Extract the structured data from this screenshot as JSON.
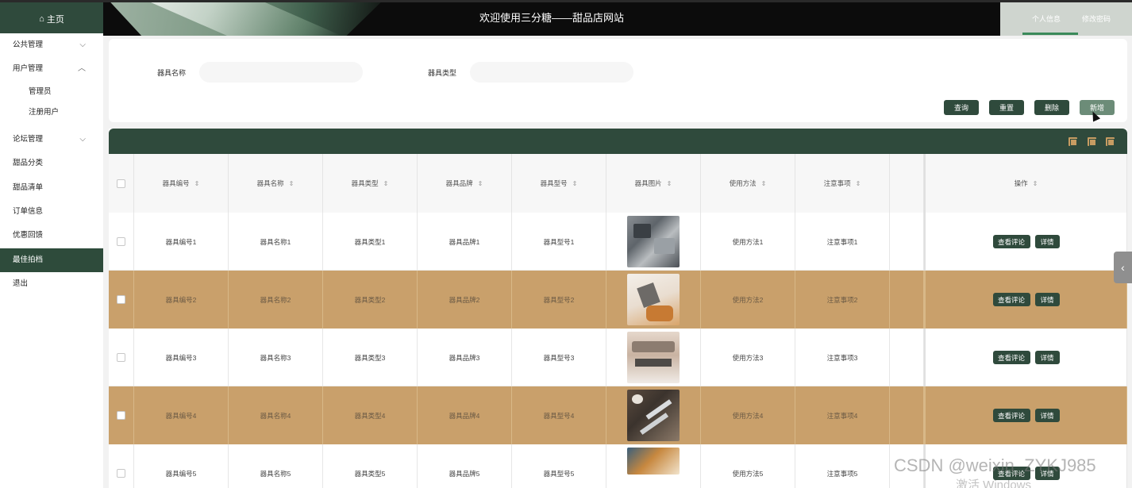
{
  "header": {
    "home_label": "主页",
    "site_title": "欢迎使用三分糖——甜品店网站",
    "links": [
      "个人信息",
      "修改密码"
    ]
  },
  "sidebar": {
    "items": [
      {
        "label": "公共管理",
        "chevron": "chevron-down-icon"
      },
      {
        "label": "用户管理",
        "chevron": "chevron-up-icon"
      },
      {
        "label": "管理员"
      },
      {
        "label": "注册用户"
      },
      {
        "label": "论坛管理",
        "chevron": "chevron-down-icon"
      },
      {
        "label": "甜品分类"
      },
      {
        "label": "甜品清单"
      },
      {
        "label": "订单信息"
      },
      {
        "label": "优惠回馈"
      },
      {
        "label": "最佳拍档"
      },
      {
        "label": "退出"
      }
    ],
    "active_index": 9
  },
  "search": {
    "name_label": "器具名称",
    "name_value": "",
    "type_label": "器具类型",
    "type_value": "",
    "buttons": {
      "query": "查询",
      "reset": "重置",
      "delete": "删除",
      "add": "新增"
    }
  },
  "table": {
    "columns": [
      "器具编号",
      "器具名称",
      "器具类型",
      "器具品牌",
      "器具型号",
      "器具图片",
      "使用方法",
      "注意事项",
      "",
      "操作"
    ],
    "rows": [
      {
        "no": "器具编号1",
        "name": "器具名称1",
        "type": "器具类型1",
        "brand": "器具品牌1",
        "model": "器具型号1",
        "usage": "使用方法1",
        "notes": "注意事项1"
      },
      {
        "no": "器具编号2",
        "name": "器具名称2",
        "type": "器具类型2",
        "brand": "器具品牌2",
        "model": "器具型号2",
        "usage": "使用方法2",
        "notes": "注意事项2"
      },
      {
        "no": "器具编号3",
        "name": "器具名称3",
        "type": "器具类型3",
        "brand": "器具品牌3",
        "model": "器具型号3",
        "usage": "使用方法3",
        "notes": "注意事项3"
      },
      {
        "no": "器具编号4",
        "name": "器具名称4",
        "type": "器具类型4",
        "brand": "器具品牌4",
        "model": "器具型号4",
        "usage": "使用方法4",
        "notes": "注意事项4"
      },
      {
        "no": "器具编号5",
        "name": "器具名称5",
        "type": "器具类型5",
        "brand": "器具品牌5",
        "model": "器具型号5",
        "usage": "使用方法5",
        "notes": "注意事项5"
      }
    ],
    "row_actions": {
      "comments": "查看评论",
      "detail": "详情"
    }
  },
  "overlay": {
    "watermark": "CSDN @weixin_ZYKJ985",
    "activate_windows": "激活 Windows"
  },
  "colors": {
    "primary": "#2f4a3c",
    "accent_row": "#c9a06b",
    "top_bar": "#0c0c0c"
  }
}
